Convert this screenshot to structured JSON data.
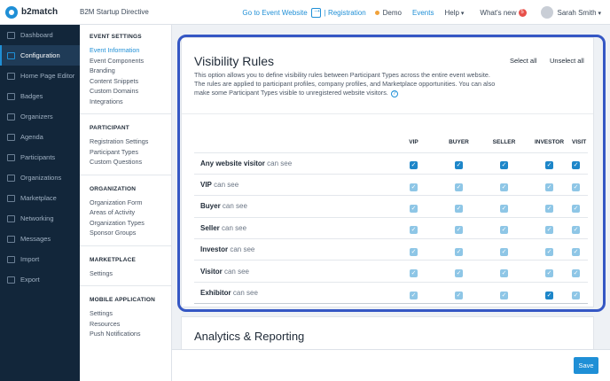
{
  "brand": {
    "logo_text": "b2match"
  },
  "header": {
    "event_title": "B2M Startup Directive",
    "goto_label": "Go to Event Website",
    "registration_label": "| Registration",
    "demo_label": "Demo",
    "events_label": "Events",
    "help_label": "Help",
    "whats_new_label": "What's new",
    "whats_new_count": "5",
    "user_name": "Sarah Smith"
  },
  "sidebar": {
    "items": [
      {
        "label": "Dashboard",
        "icon": "dashboard-icon"
      },
      {
        "label": "Configuration",
        "icon": "configuration-icon",
        "active": true
      },
      {
        "label": "Home Page Editor",
        "icon": "home-page-icon"
      },
      {
        "label": "Badges",
        "icon": "badge-icon"
      },
      {
        "label": "Organizers",
        "icon": "organizers-icon"
      },
      {
        "label": "Agenda",
        "icon": "agenda-icon"
      },
      {
        "label": "Participants",
        "icon": "participants-icon"
      },
      {
        "label": "Organizations",
        "icon": "organizations-icon"
      },
      {
        "label": "Marketplace",
        "icon": "marketplace-icon"
      },
      {
        "label": "Networking",
        "icon": "networking-icon"
      },
      {
        "label": "Messages",
        "icon": "messages-icon"
      },
      {
        "label": "Import",
        "icon": "import-icon"
      },
      {
        "label": "Export",
        "icon": "export-icon"
      }
    ]
  },
  "subnav": {
    "sections": [
      {
        "heading": "EVENT SETTINGS",
        "links": [
          "Event Information",
          "Event Components",
          "Branding",
          "Content Snippets",
          "Custom Domains",
          "Integrations"
        ]
      },
      {
        "heading": "PARTICIPANT",
        "links": [
          "Registration Settings",
          "Participant Types",
          "Custom Questions"
        ]
      },
      {
        "heading": "ORGANIZATION",
        "links": [
          "Organization Form",
          "Areas of Activity",
          "Organization Types",
          "Sponsor Groups"
        ]
      },
      {
        "heading": "MARKETPLACE",
        "links": [
          "Settings"
        ]
      },
      {
        "heading": "MOBILE APPLICATION",
        "links": [
          "Settings",
          "Resources",
          "Push Notifications"
        ]
      }
    ]
  },
  "visibility": {
    "title": "Visibility Rules",
    "select_all": "Select all",
    "unselect_all": "Unselect all",
    "description": "This option allows you to define visibility rules between Participant Types across the entire event website. The rules are applied to participant profiles, company profiles, and Marketplace opportunities. You can also make some Participant Types visible to unregistered website visitors.",
    "columns": [
      "VIP",
      "BUYER",
      "SELLER",
      "INVESTOR",
      "VISIT"
    ],
    "can_see": "can see",
    "rows": [
      {
        "name": "Any website visitor"
      },
      {
        "name": "VIP"
      },
      {
        "name": "Buyer"
      },
      {
        "name": "Seller"
      },
      {
        "name": "Investor"
      },
      {
        "name": "Visitor"
      },
      {
        "name": "Exhibitor"
      }
    ]
  },
  "analytics": {
    "title": "Analytics & Reporting"
  },
  "footer": {
    "save_label": "Save"
  },
  "colors": {
    "accent": "#1f8fd6",
    "sidebar": "#12263a",
    "highlight": "#3557c4"
  }
}
